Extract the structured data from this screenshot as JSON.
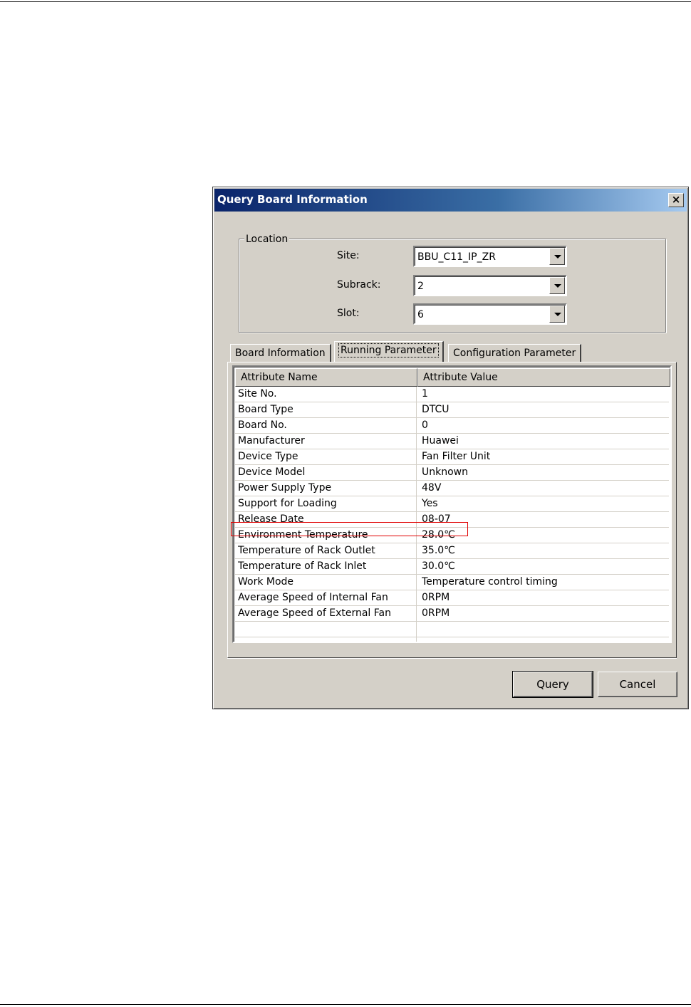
{
  "dialog": {
    "title": "Query Board Information",
    "close_glyph": "×"
  },
  "location": {
    "legend": "Location",
    "site_label": "Site:",
    "site_value": "BBU_C11_IP_ZR",
    "subrack_label": "Subrack:",
    "subrack_value": "2",
    "slot_label": "Slot:",
    "slot_value": "6"
  },
  "tabs": [
    {
      "label": "Board Information",
      "active": false
    },
    {
      "label": "Running Parameter",
      "active": true
    },
    {
      "label": "Configuration Parameter",
      "active": false
    }
  ],
  "grid": {
    "columns": [
      "Attribute Name",
      "Attribute Value"
    ],
    "rows": [
      {
        "name": "Site No.",
        "value": "1"
      },
      {
        "name": "Board Type",
        "value": "DTCU"
      },
      {
        "name": "Board No.",
        "value": "0"
      },
      {
        "name": "Manufacturer",
        "value": "Huawei"
      },
      {
        "name": "Device Type",
        "value": "Fan Filter Unit"
      },
      {
        "name": "Device Model",
        "value": "Unknown"
      },
      {
        "name": "Power Supply Type",
        "value": "48V"
      },
      {
        "name": "Support for Loading",
        "value": "Yes"
      },
      {
        "name": "Release Date",
        "value": "08-07"
      },
      {
        "name": "Environment Temperature",
        "value": "28.0℃"
      },
      {
        "name": "Temperature of Rack Outlet",
        "value": "35.0℃"
      },
      {
        "name": "Temperature of Rack Inlet",
        "value": "30.0℃"
      },
      {
        "name": "Work Mode",
        "value": "Temperature control timing"
      },
      {
        "name": "Average Speed of Internal Fan",
        "value": "0RPM"
      },
      {
        "name": "Average Speed of External Fan",
        "value": "0RPM"
      },
      {
        "name": "",
        "value": ""
      },
      {
        "name": "",
        "value": ""
      }
    ],
    "highlighted_row": "Environment Temperature"
  },
  "buttons": {
    "query": "Query",
    "cancel": "Cancel"
  },
  "colors": {
    "dialog_bg": "#d4d0c8",
    "titlebar_start": "#0a246a",
    "titlebar_end": "#a6caf0",
    "highlight_border": "#e00000"
  }
}
